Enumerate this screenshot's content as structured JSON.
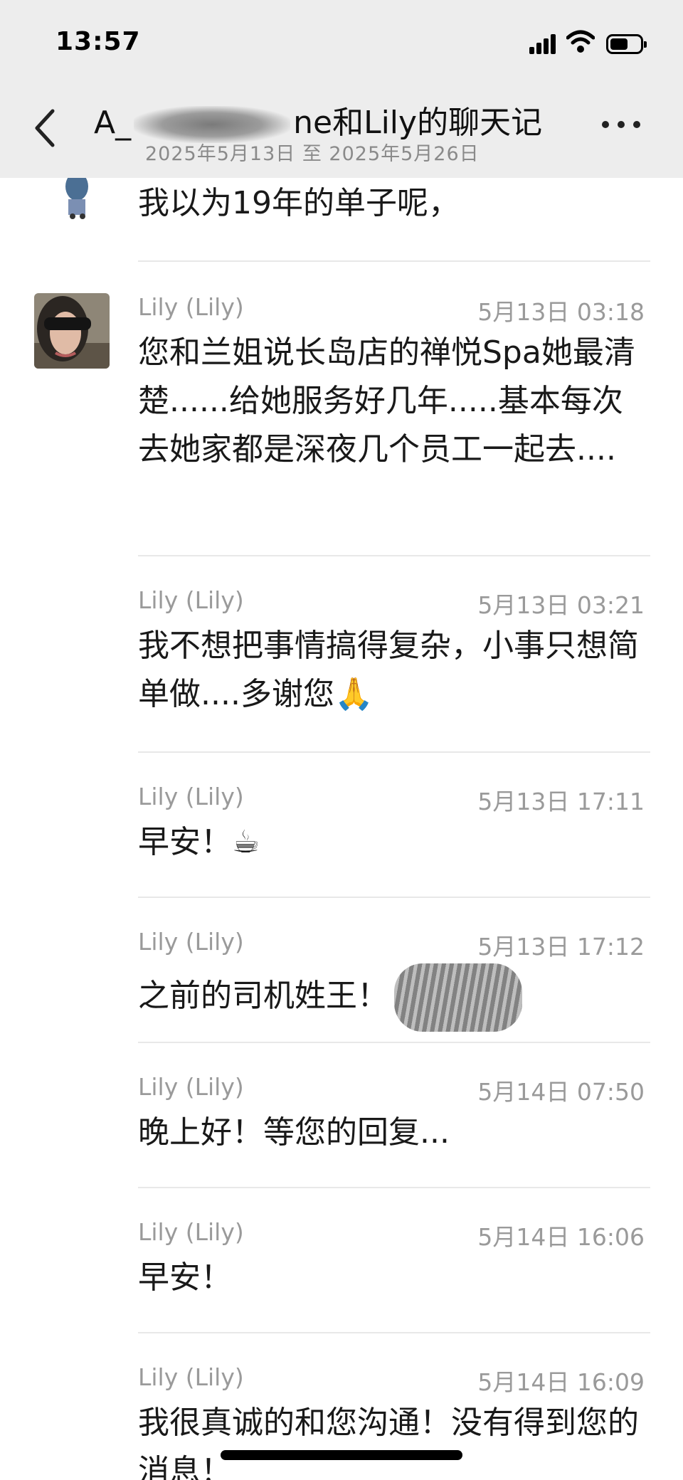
{
  "status_bar": {
    "time": "13:57"
  },
  "header": {
    "title_prefix": "A_",
    "title_suffix": "ne和Lily的聊天记",
    "subtitle": "2025年5月13日 至 2025年5月26日"
  },
  "messages": [
    {
      "sender": "",
      "time": "",
      "text": "我以为19年的单子呢，"
    },
    {
      "sender": "Lily (Lily)",
      "time": "5月13日 03:18",
      "text": "您和兰姐说长岛店的禅悦Spa她最清楚......给她服务好几年.....基本每次去她家都是深夜几个员工一起去...."
    },
    {
      "sender": "Lily (Lily)",
      "time": "5月13日 03:21",
      "text": "我不想把事情搞得复杂，小事只想简单做....多谢您🙏"
    },
    {
      "sender": "Lily (Lily)",
      "time": "5月13日 17:11",
      "text": "早安！☕"
    },
    {
      "sender": "Lily (Lily)",
      "time": "5月13日 17:12",
      "text": "之前的司机姓王！"
    },
    {
      "sender": "Lily (Lily)",
      "time": "5月14日 07:50",
      "text": "晚上好！等您的回复..."
    },
    {
      "sender": "Lily (Lily)",
      "time": "5月14日 16:06",
      "text": "早安！"
    },
    {
      "sender": "Lily (Lily)",
      "time": "5月14日 16:09",
      "text": "我很真诚的和您沟通！没有得到您的消息！"
    }
  ],
  "icons": {
    "back": "chevron-left-icon",
    "more": "more-dots-icon",
    "signal": "signal-icon",
    "wifi": "wifi-icon",
    "battery": "battery-icon"
  }
}
